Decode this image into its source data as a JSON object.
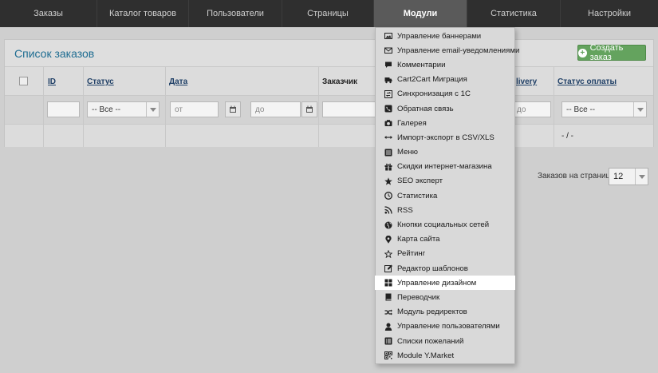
{
  "nav": {
    "items": [
      {
        "label": "Заказы",
        "active": false
      },
      {
        "label": "Каталог товаров",
        "active": false
      },
      {
        "label": "Пользователи",
        "active": false
      },
      {
        "label": "Страницы",
        "active": false
      },
      {
        "label": "Модули",
        "active": true
      },
      {
        "label": "Статистика",
        "active": false
      },
      {
        "label": "Настройки",
        "active": false
      }
    ]
  },
  "orders": {
    "title": "Список заказов",
    "create_label": "Создать заказ",
    "columns": {
      "id": "ID",
      "status": "Статус",
      "date": "Дата",
      "customer": "Заказчик",
      "delivery": "livery",
      "payment_status": "Статус оплаты"
    },
    "filters": {
      "status_value": "-- Все --",
      "date_from_placeholder": "от",
      "date_to_placeholder": "до",
      "delivery_placeholder": "до",
      "payment_value": "-- Все --"
    },
    "empty_row_payment": "- / -",
    "per_page_label": "Заказов на странице",
    "per_page_value": "12"
  },
  "modules_menu": {
    "items": [
      {
        "label": "Управление баннерами",
        "icon": "image-icon"
      },
      {
        "label": "Управление email-уведомлениями",
        "icon": "envelope-icon"
      },
      {
        "label": "Комментарии",
        "icon": "comment-icon"
      },
      {
        "label": "Cart2Cart Миграция",
        "icon": "truck-icon"
      },
      {
        "label": "Синхронизация с 1С",
        "icon": "sync-icon"
      },
      {
        "label": "Обратная связь",
        "icon": "phone-icon"
      },
      {
        "label": "Галерея",
        "icon": "camera-icon"
      },
      {
        "label": "Импорт-экспорт в CSV/XLS",
        "icon": "arrows-horizontal-icon"
      },
      {
        "label": "Меню",
        "icon": "list-icon"
      },
      {
        "label": "Скидки интернет-магазина",
        "icon": "gift-icon"
      },
      {
        "label": "SEO эксперт",
        "icon": "star-icon"
      },
      {
        "label": "Статистика",
        "icon": "clock-icon"
      },
      {
        "label": "RSS",
        "icon": "rss-icon"
      },
      {
        "label": "Кнопки социальных сетей",
        "icon": "globe-icon"
      },
      {
        "label": "Карта сайта",
        "icon": "map-marker-icon"
      },
      {
        "label": "Рейтинг",
        "icon": "star-outline-icon"
      },
      {
        "label": "Редактор шаблонов",
        "icon": "edit-icon"
      },
      {
        "label": "Управление дизайном",
        "icon": "grid-icon"
      },
      {
        "label": "Переводчик",
        "icon": "book-icon"
      },
      {
        "label": "Модуль редиректов",
        "icon": "random-icon"
      },
      {
        "label": "Управление пользователями",
        "icon": "user-icon"
      },
      {
        "label": "Списки пожеланий",
        "icon": "list-alt-icon"
      },
      {
        "label": "Module Y.Market",
        "icon": "qrcode-icon"
      }
    ],
    "highlighted_index": 17
  }
}
